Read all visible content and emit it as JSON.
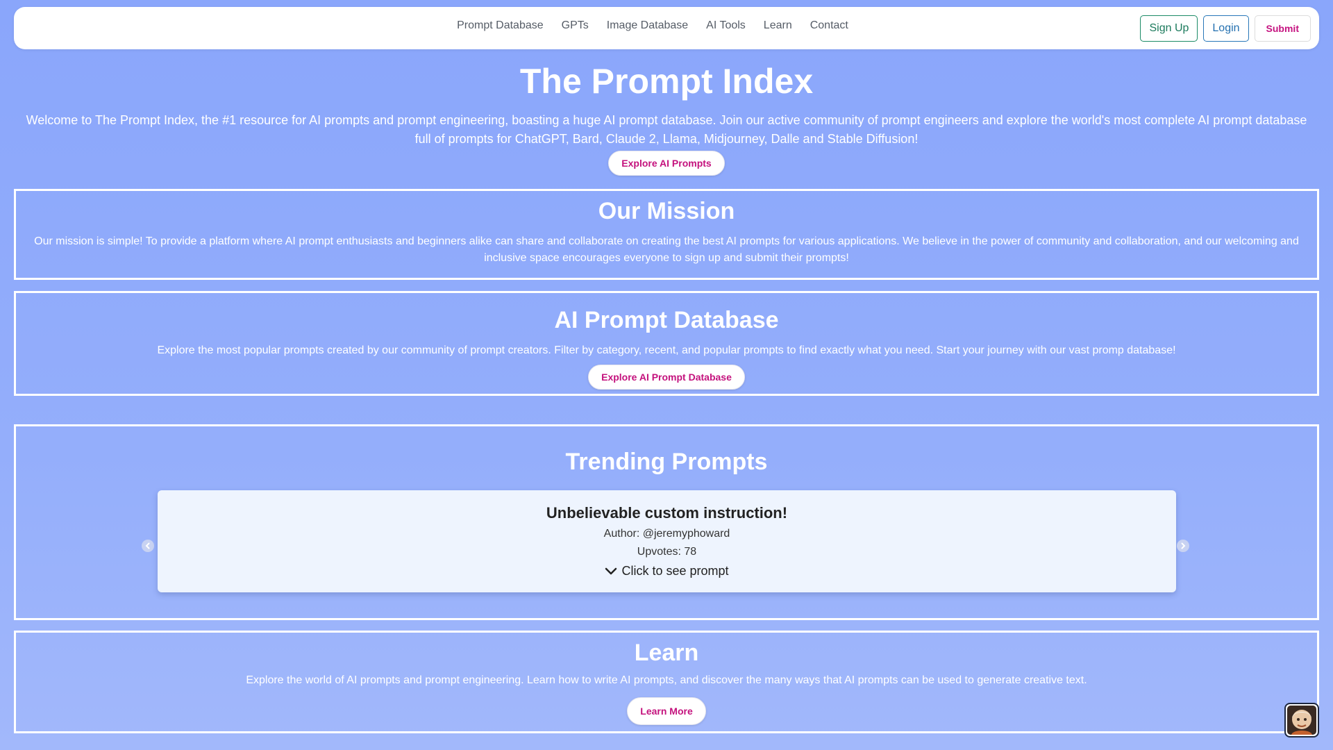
{
  "nav": {
    "links": [
      "Prompt Database",
      "GPTs",
      "Image Database",
      "AI Tools",
      "Learn",
      "Contact"
    ],
    "signup_label": "Sign Up",
    "login_label": "Login",
    "submit_label": "Submit"
  },
  "hero": {
    "title": "The Prompt Index",
    "text": "Welcome to The Prompt Index, the #1 resource for AI prompts and prompt engineering, boasting a huge AI prompt database. Join our active community of prompt engineers and explore the world's most complete AI prompt database full of prompts for ChatGPT, Bard, Claude 2, Llama, Midjourney, Dalle and Stable Diffusion!",
    "button_label": "Explore AI Prompts"
  },
  "mission": {
    "title": "Our Mission",
    "text": "Our mission is simple! To provide a platform where AI prompt enthusiasts and beginners alike can share and collaborate on creating the best AI prompts for various applications. We believe in the power of community and collaboration, and our welcoming and inclusive space encourages everyone to sign up and submit their prompts!"
  },
  "database": {
    "title": "AI Prompt Database",
    "text": "Explore the most popular prompts created by our community of prompt creators. Filter by category, recent, and popular prompts to find exactly what you need. Start your journey with our vast promp database!",
    "button_label": "Explore AI Prompt Database"
  },
  "trending": {
    "title": "Trending Prompts",
    "card": {
      "title": "Unbelievable custom instruction!",
      "author": "Author: @jeremyphoward",
      "upvotes": "Upvotes: 78",
      "toggle_label": "Click to see prompt"
    }
  },
  "learn": {
    "title": "Learn",
    "text": "Explore the world of AI prompts and prompt engineering. Learn how to write AI prompts, and discover the many ways that AI prompts can be used to generate creative text.",
    "button_label": "Learn More"
  },
  "colors": {
    "background": "#8aa6fb",
    "accent_pink": "#c4127d",
    "signup_green": "#1b7a5c",
    "login_blue": "#2470b0"
  },
  "icons": {
    "arrow_left": "chevron-left-circle-icon",
    "arrow_right": "chevron-right-circle-icon",
    "toggle": "chevron-down-icon",
    "avatar": "chat-assistant-avatar-icon"
  }
}
